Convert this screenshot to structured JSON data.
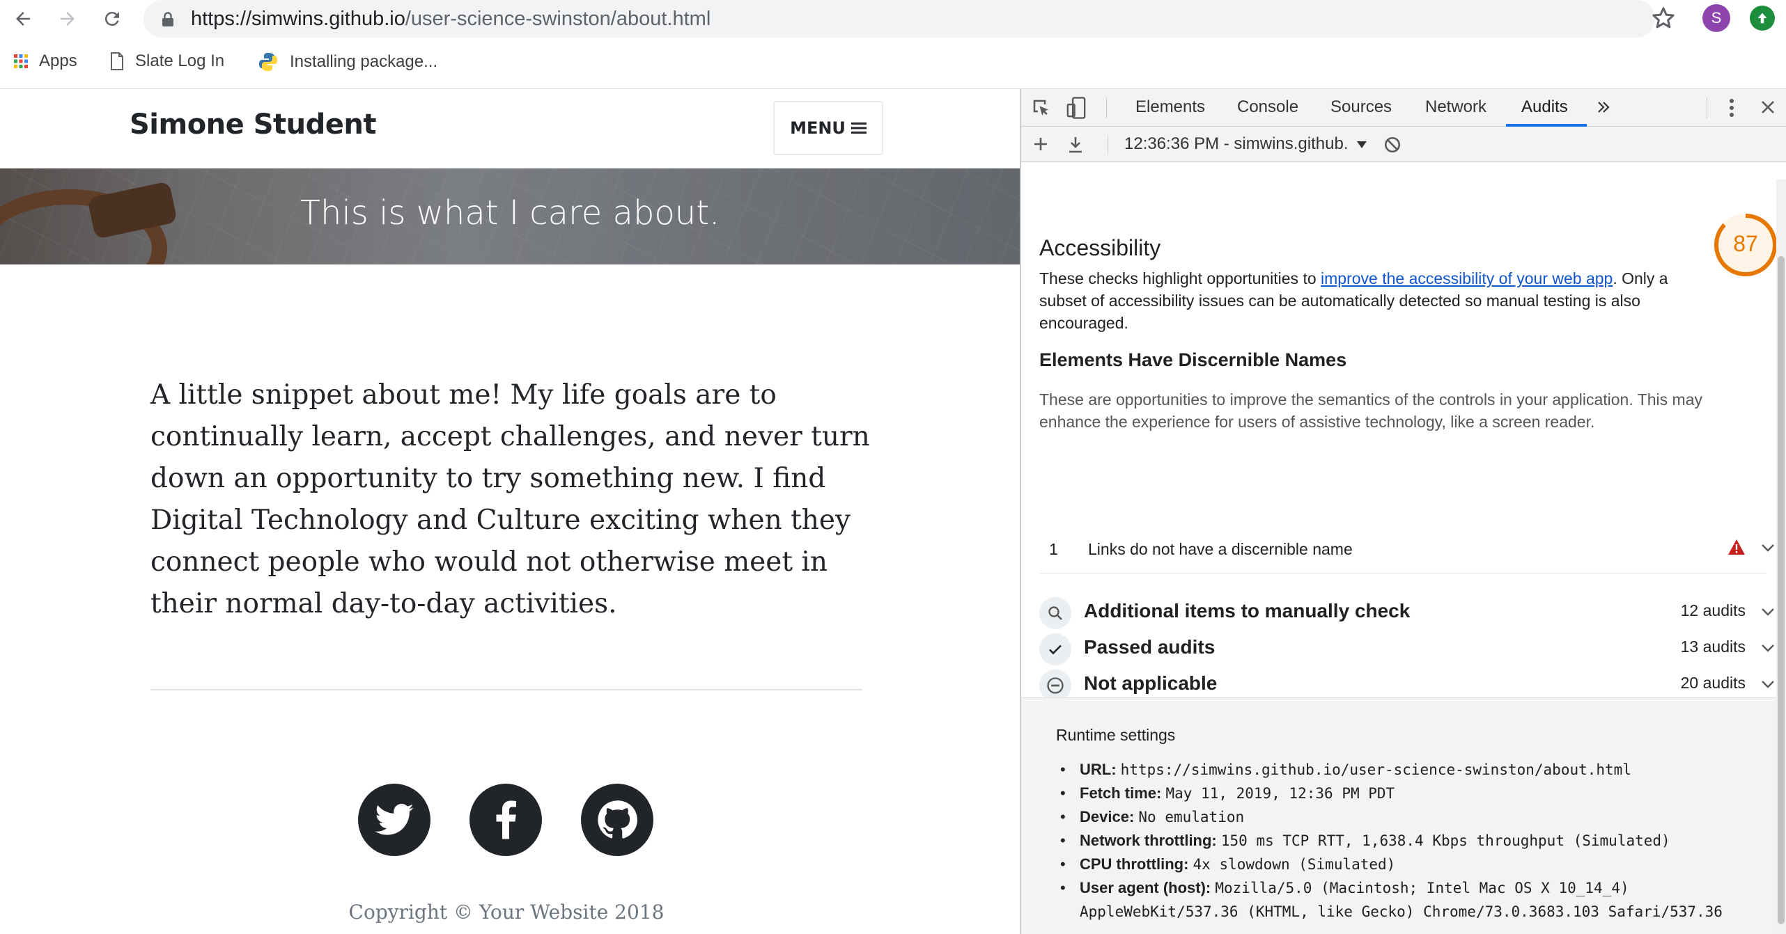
{
  "browser": {
    "url_host": "https://simwins.github.io",
    "url_path": "/user-science-swinston/about.html",
    "profile_initial": "S",
    "bookmarks": [
      {
        "label": "Apps",
        "icon": "apps-grid-icon"
      },
      {
        "label": "Slate Log In",
        "icon": "page-icon"
      },
      {
        "label": "Installing package...",
        "icon": "python-icon"
      }
    ]
  },
  "site": {
    "brand": "Simone Student",
    "menu_label": "MENU",
    "hero_text": "This is what I care about.",
    "about": "A little snippet about me! My life goals are to continually learn, accept challenges, and never turn down an opportunity to try something new. I find Digital Technology and Culture exciting when they connect people who would not otherwise meet in their normal day-to-day activities.",
    "social": [
      "twitter-icon",
      "facebook-icon",
      "github-icon"
    ],
    "copyright": "Copyright © Your Website 2018"
  },
  "devtools": {
    "tabs": [
      "Elements",
      "Console",
      "Sources",
      "Network",
      "Audits"
    ],
    "active_tab": "Audits",
    "report_selector": "12:36:36 PM - simwins.github.",
    "accessibility": {
      "title": "Accessibility",
      "desc_before": "These checks highlight opportunities to ",
      "desc_link": "improve the accessibility of your web app",
      "desc_after": ". Only a subset of accessibility issues can be automatically detected so manual testing is also encouraged.",
      "score": "87",
      "score_fraction": 0.87,
      "score_color": "#e67700"
    },
    "group": {
      "title": "Elements Have Discernible Names",
      "desc": "These are opportunities to improve the semantics of the controls in your application. This may enhance the experience for users of assistive technology, like a screen reader.",
      "audit_num": "1",
      "audit_text": "Links do not have a discernible name"
    },
    "clusters": [
      {
        "title": "Additional items to manually check",
        "count": "12 audits",
        "icon": "search-icon"
      },
      {
        "title": "Passed audits",
        "count": "13 audits",
        "icon": "check-icon"
      },
      {
        "title": "Not applicable",
        "count": "20 audits",
        "icon": "minus-circle-icon"
      }
    ],
    "runtime": {
      "title": "Runtime settings",
      "items": [
        {
          "k": "URL:",
          "v": "https://simwins.github.io/user-science-swinston/about.html"
        },
        {
          "k": "Fetch time:",
          "v": "May 11, 2019, 12:36 PM PDT"
        },
        {
          "k": "Device:",
          "v": "No emulation"
        },
        {
          "k": "Network throttling:",
          "v": "150 ms TCP RTT, 1,638.4 Kbps throughput (Simulated)"
        },
        {
          "k": "CPU throttling:",
          "v": "4x slowdown (Simulated)"
        },
        {
          "k": "User agent (host):",
          "v": "Mozilla/5.0 (Macintosh; Intel Mac OS X 10_14_4)"
        },
        {
          "k": "",
          "v": "AppleWebKit/537.36 (KHTML, like Gecko) Chrome/73.0.3683.103 Safari/537.36"
        }
      ]
    }
  }
}
